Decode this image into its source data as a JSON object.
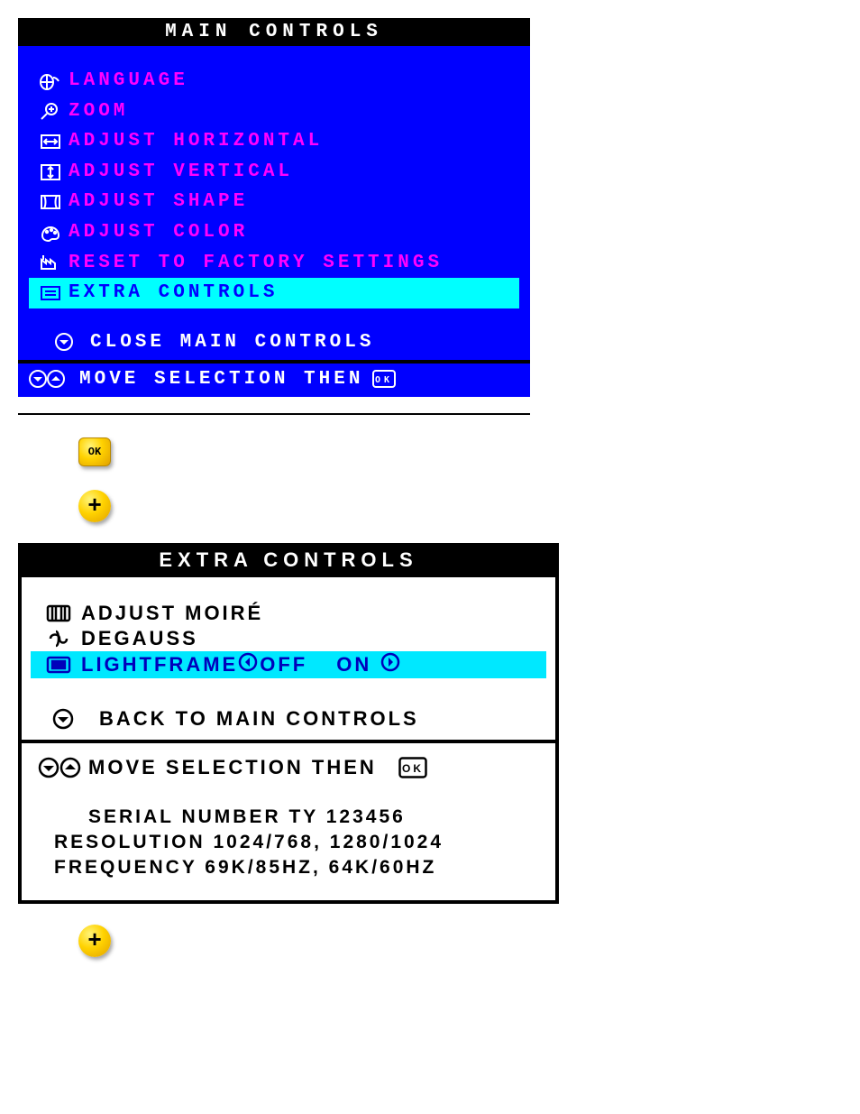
{
  "main": {
    "title": "MAIN CONTROLS",
    "items": [
      {
        "label": "LANGUAGE"
      },
      {
        "label": "ZOOM"
      },
      {
        "label": "ADJUST HORIZONTAL"
      },
      {
        "label": "ADJUST VERTICAL"
      },
      {
        "label": "ADJUST SHAPE"
      },
      {
        "label": "ADJUST COLOR"
      },
      {
        "label": "RESET TO FACTORY SETTINGS"
      },
      {
        "label": "EXTRA CONTROLS"
      }
    ],
    "close": "CLOSE MAIN CONTROLS",
    "footer": "MOVE SELECTION THEN"
  },
  "steps": {
    "ok": "OK",
    "plus": "+"
  },
  "extra": {
    "title": "EXTRA CONTROLS",
    "items": [
      {
        "label": "ADJUST MOIRÉ"
      },
      {
        "label": "DEGAUSS"
      },
      {
        "label": "LIGHTFRAME",
        "off": "OFF",
        "on": "ON"
      }
    ],
    "back": "BACK TO MAIN CONTROLS",
    "footer_move": "MOVE SELECTION THEN",
    "serial": "SERIAL NUMBER TY 123456",
    "resolution": "RESOLUTION 1024/768, 1280/1024",
    "frequency": "FREQUENCY 69K/85HZ, 64K/60HZ"
  }
}
